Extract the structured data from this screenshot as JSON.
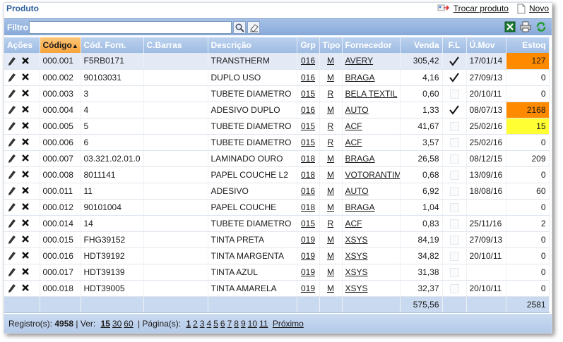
{
  "title": "Produto",
  "top_actions": {
    "swap_label": "Trocar produto",
    "new_label": "Novo"
  },
  "filter": {
    "label": "Filtro:",
    "value": ""
  },
  "columns": {
    "acoes": "Ações",
    "codigo": "Código",
    "cod_forn": "Cód. Forn.",
    "cbarras": "C.Barras",
    "descricao": "Descrição",
    "grp": "Grp",
    "tipo": "Tipo",
    "fornecedor": "Fornecedor",
    "venda": "Venda",
    "fl": "F.L",
    "umov": "Ú.Mov",
    "estoq": "Estoq"
  },
  "rows": [
    {
      "codigo": "000.001",
      "cod_forn": "F5RB0171",
      "cbarras": "",
      "descricao": "TRANSTHERM",
      "grp": "016",
      "tipo": "M",
      "fornecedor": "AVERY",
      "venda": "305,42",
      "fl": true,
      "umov": "17/01/14",
      "estoq": "127",
      "highlight": "orange",
      "selected": true
    },
    {
      "codigo": "000.002",
      "cod_forn": "90103031",
      "cbarras": "",
      "descricao": "DUPLO USO",
      "grp": "016",
      "tipo": "M",
      "fornecedor": "BRAGA",
      "venda": "4,16",
      "fl": true,
      "umov": "27/09/13",
      "estoq": "0",
      "highlight": "",
      "selected": false
    },
    {
      "codigo": "000.003",
      "cod_forn": "3",
      "cbarras": "",
      "descricao": "TUBETE DIAMETRO",
      "grp": "015",
      "tipo": "R",
      "fornecedor": "BELA TEXTIL",
      "venda": "0,60",
      "fl": false,
      "umov": "20/10/11",
      "estoq": "0",
      "highlight": "",
      "selected": false
    },
    {
      "codigo": "000.004",
      "cod_forn": "4",
      "cbarras": "",
      "descricao": "ADESIVO DUPLO",
      "grp": "016",
      "tipo": "M",
      "fornecedor": "AUTO",
      "venda": "1,33",
      "fl": true,
      "umov": "08/07/13",
      "estoq": "2168",
      "highlight": "orange",
      "selected": false
    },
    {
      "codigo": "000.005",
      "cod_forn": "5",
      "cbarras": "",
      "descricao": "TUBETE DIAMETRO",
      "grp": "015",
      "tipo": "R",
      "fornecedor": "ACF",
      "venda": "41,67",
      "fl": false,
      "umov": "25/02/16",
      "estoq": "15",
      "highlight": "yellow",
      "selected": false
    },
    {
      "codigo": "000.006",
      "cod_forn": "6",
      "cbarras": "",
      "descricao": "TUBETE DIAMETRO",
      "grp": "015",
      "tipo": "R",
      "fornecedor": "ACF",
      "venda": "3,57",
      "fl": false,
      "umov": "25/02/16",
      "estoq": "0",
      "highlight": "",
      "selected": false
    },
    {
      "codigo": "000.007",
      "cod_forn": "03.321.02.01.0",
      "cbarras": "",
      "descricao": "LAMINADO OURO",
      "grp": "018",
      "tipo": "M",
      "fornecedor": "BRAGA",
      "venda": "26,58",
      "fl": false,
      "umov": "08/12/15",
      "estoq": "209",
      "highlight": "",
      "selected": false
    },
    {
      "codigo": "000.008",
      "cod_forn": "8011141",
      "cbarras": "",
      "descricao": "PAPEL COUCHE L2",
      "grp": "018",
      "tipo": "M",
      "fornecedor": "VOTORANTIM",
      "venda": "0,68",
      "fl": false,
      "umov": "13/09/16",
      "estoq": "0",
      "highlight": "",
      "selected": false
    },
    {
      "codigo": "000.011",
      "cod_forn": "11",
      "cbarras": "",
      "descricao": "ADESIVO",
      "grp": "016",
      "tipo": "M",
      "fornecedor": "AUTO",
      "venda": "6,92",
      "fl": false,
      "umov": "18/08/16",
      "estoq": "60",
      "highlight": "",
      "selected": false
    },
    {
      "codigo": "000.012",
      "cod_forn": "90101004",
      "cbarras": "",
      "descricao": "PAPEL COUCHE",
      "grp": "018",
      "tipo": "M",
      "fornecedor": "BRAGA",
      "venda": "1,04",
      "fl": false,
      "umov": "",
      "estoq": "0",
      "highlight": "",
      "selected": false
    },
    {
      "codigo": "000.014",
      "cod_forn": "14",
      "cbarras": "",
      "descricao": "TUBETE DIAMETRO",
      "grp": "015",
      "tipo": "R",
      "fornecedor": "ACF",
      "venda": "0,83",
      "fl": false,
      "umov": "25/11/16",
      "estoq": "2",
      "highlight": "",
      "selected": false
    },
    {
      "codigo": "000.015",
      "cod_forn": "FHG39152",
      "cbarras": "",
      "descricao": "TINTA PRETA",
      "grp": "019",
      "tipo": "M",
      "fornecedor": "XSYS",
      "venda": "84,19",
      "fl": false,
      "umov": "27/09/13",
      "estoq": "0",
      "highlight": "",
      "selected": false
    },
    {
      "codigo": "000.016",
      "cod_forn": "HDT39192",
      "cbarras": "",
      "descricao": "TINTA MARGENTA",
      "grp": "019",
      "tipo": "M",
      "fornecedor": "XSYS",
      "venda": "34,82",
      "fl": false,
      "umov": "20/10/11",
      "estoq": "0",
      "highlight": "",
      "selected": false
    },
    {
      "codigo": "000.017",
      "cod_forn": "HDT39139",
      "cbarras": "",
      "descricao": "TINTA AZUL",
      "grp": "019",
      "tipo": "M",
      "fornecedor": "XSYS",
      "venda": "31,38",
      "fl": false,
      "umov": "",
      "estoq": "0",
      "highlight": "",
      "selected": false
    },
    {
      "codigo": "000.018",
      "cod_forn": "HDT39005",
      "cbarras": "",
      "descricao": "TINTA AMARELA",
      "grp": "019",
      "tipo": "M",
      "fornecedor": "XSYS",
      "venda": "32,37",
      "fl": false,
      "umov": "20/10/11",
      "estoq": "0",
      "highlight": "",
      "selected": false
    }
  ],
  "totals": {
    "venda": "575,56",
    "estoq": "2581"
  },
  "pager": {
    "records_label": "Registro(s):",
    "records_count": "4958",
    "ver_label": "| Ver:",
    "page_sizes": [
      "15",
      "30",
      "60"
    ],
    "pages_label": "| Página(s):",
    "pages": [
      "1",
      "2",
      "3",
      "4",
      "5",
      "6",
      "7",
      "8",
      "9",
      "10",
      "11"
    ],
    "next_label": "Próximo"
  },
  "colors": {
    "highlight_orange": "#ff8a00",
    "highlight_yellow": "#ffff33",
    "header_blue": "#9ebce2",
    "title_blue": "#2e5f9a"
  }
}
